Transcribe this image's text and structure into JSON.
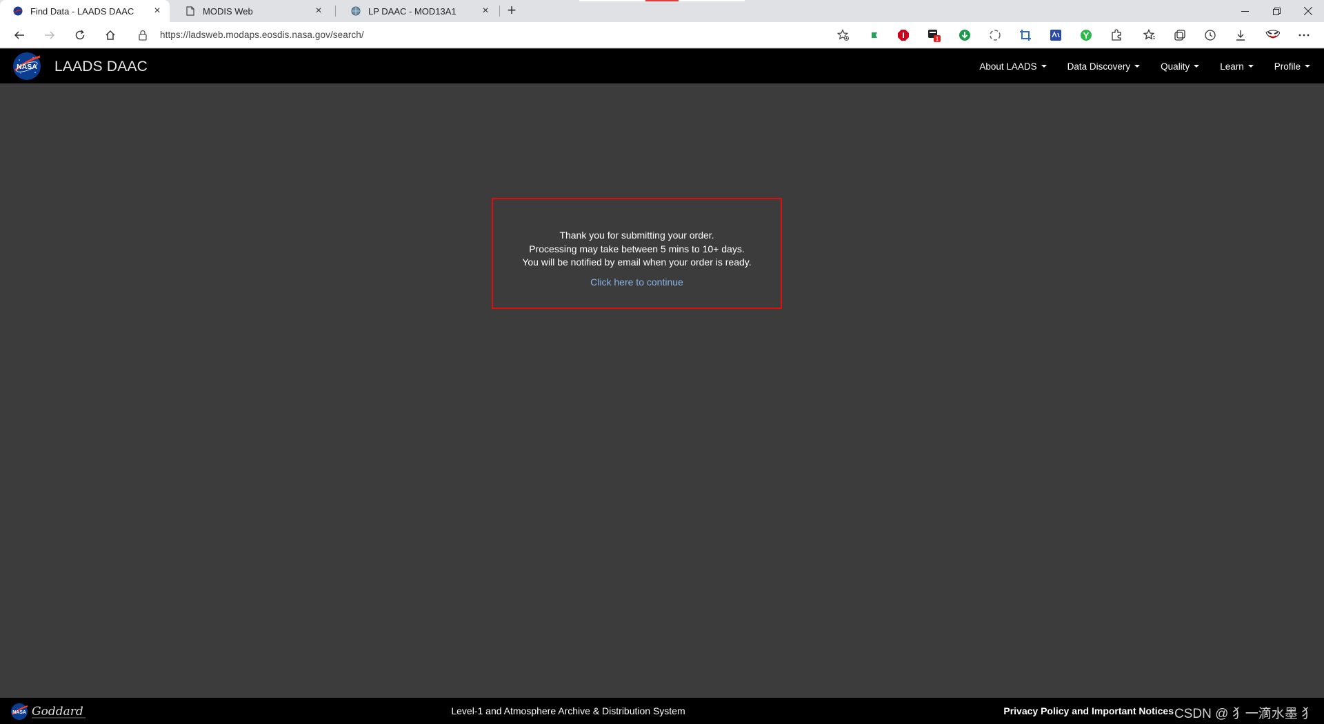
{
  "browser": {
    "tabs": [
      {
        "title": "Find Data - LAADS DAAC",
        "active": true
      },
      {
        "title": "MODIS Web",
        "active": false
      },
      {
        "title": "LP DAAC - MOD13A1",
        "active": false
      }
    ],
    "url": "https://ladsweb.modaps.eosdis.nasa.gov/search/",
    "extension_badge": "1"
  },
  "site": {
    "logo_text": "NASA",
    "title": "LAADS DAAC",
    "nav": [
      {
        "label": "About LAADS"
      },
      {
        "label": "Data Discovery"
      },
      {
        "label": "Quality"
      },
      {
        "label": "Learn"
      },
      {
        "label": "Profile"
      }
    ]
  },
  "message": {
    "line1": "Thank you for submitting your order.",
    "line2": "Processing may take between 5 mins to 10+ days.",
    "line3": "You will be notified by email when your order is ready.",
    "continue_link": "Click here to continue"
  },
  "footer": {
    "goddard_text": "Goddard",
    "title": "Level-1 and Atmosphere Archive & Distribution System",
    "privacy": "Privacy Policy and Important Notices",
    "watermark": "CSDN @ ⺨一滴水墨 ⺨"
  },
  "colors": {
    "page_bg": "#3c3c3c",
    "header_bg": "#000000",
    "box_border": "#e00d0d",
    "link": "#8ab4e8"
  }
}
